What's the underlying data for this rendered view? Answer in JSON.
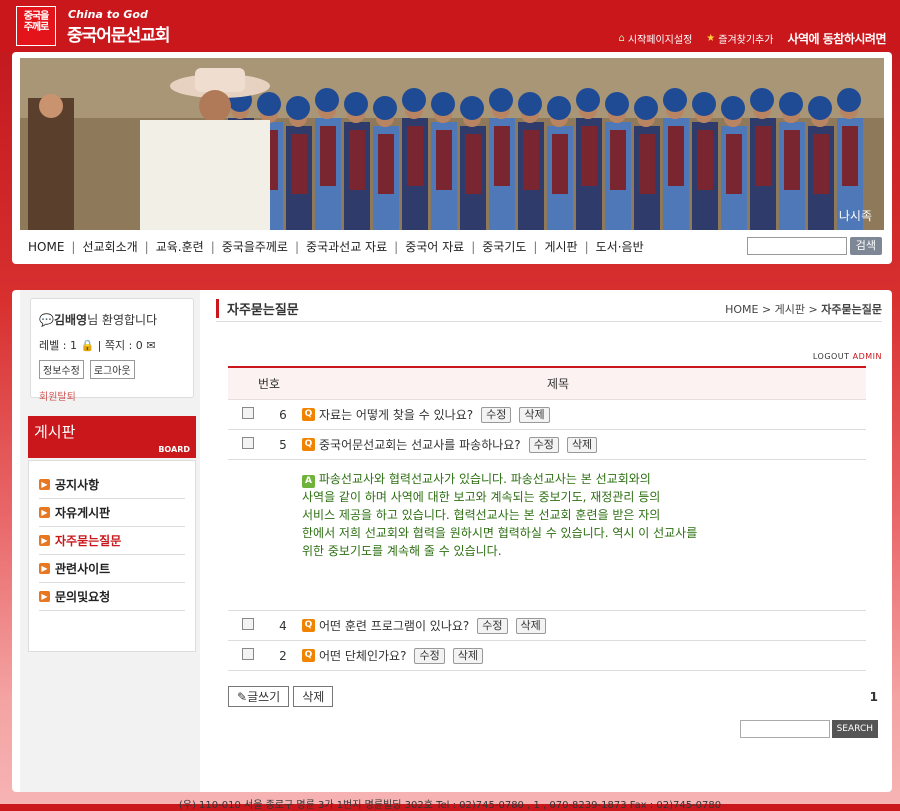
{
  "header": {
    "logo_mark": "중국을\n주께로",
    "logo_en": "China to God",
    "logo_ko": "중국어문선교회",
    "links": [
      {
        "label": "시작페이지설정",
        "icon": "home-icon"
      },
      {
        "label": "즐겨찾기추가",
        "icon": "star-icon"
      }
    ],
    "slogan": "사역에 동참하시려면"
  },
  "banner": {
    "caption": "나시족"
  },
  "nav": {
    "items": [
      "HOME",
      "선교회소개",
      "교육.훈련",
      "중국을주께로",
      "중국과선교 자료",
      "중국어 자료",
      "중국기도",
      "게시판",
      "도서·음반"
    ],
    "search_button": "검색"
  },
  "sidebar": {
    "user": "김배영",
    "welcome": "님 환영합니다",
    "level_label": "레벨 : 1",
    "memo_label": "쪽지 : 0",
    "btn_edit": "정보수정",
    "btn_logout": "로그아웃",
    "withdraw": "회원탈퇴",
    "board_title": "게시판",
    "board_en": "BOARD",
    "menu": [
      "공지사항",
      "자유게시판",
      "자주묻는질문",
      "관련사이트",
      "문의및요청"
    ]
  },
  "main": {
    "title": "자주묻는질문",
    "crumb_home": "HOME",
    "crumb_board": "게시판",
    "crumb_current": "자주묻는질문",
    "logout": "LOGOUT",
    "admin": "ADMIN",
    "col_num": "번호",
    "col_subject": "제목",
    "rows": [
      {
        "no": "6",
        "q": "자료는 어떻게 찾을 수 있나요?"
      },
      {
        "no": "5",
        "q": "중국어문선교회는 선교사를 파송하나요?"
      },
      {
        "no": "4",
        "q": "어떤 훈련 프로그램이 있나요?"
      },
      {
        "no": "2",
        "q": "어떤 단체인가요?"
      }
    ],
    "edit": "수정",
    "delete": "삭제",
    "answer_lines": [
      "파송선교사와 협력선교사가 있습니다. 파송선교사는 본 선교회와의",
      "사역을 같이 하며 사역에 대한 보고와 계속되는 중보기도, 재정관리 등의",
      "서비스 제공을 하고 있습니다. 협력선교사는 본 선교회 훈련을 받은 자의",
      "한에서 저희 선교회와 협력을 원하시면 협력하실 수 있습니다. 역시 이 선교사를",
      "위한 중보기도를 계속해 줄 수 있습니다."
    ],
    "write": "글쓰기",
    "delete_btn": "삭제",
    "page": "1",
    "search_btn": "SEARCH"
  },
  "footer": "(우) 110-010 서울 종로구 명륜 3가 1번지 명륜빌딩 302호   Tel : 02)745-0780 , 1 , 070-8239-1873   Fax : 02)745-0780"
}
